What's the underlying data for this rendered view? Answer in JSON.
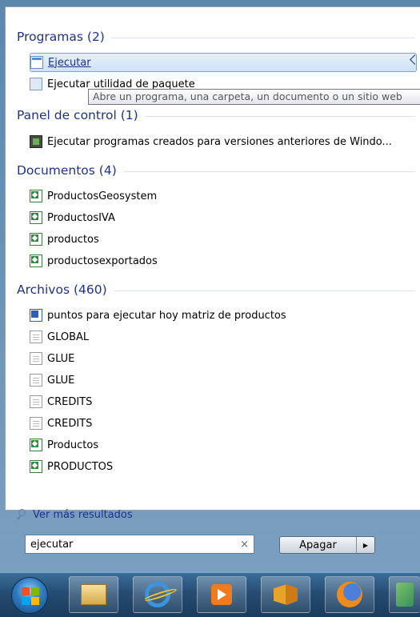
{
  "groups": {
    "programs": {
      "title": "Programas (2)",
      "items": [
        {
          "label": "Ejecutar",
          "icon": "run-icon",
          "selected": true
        },
        {
          "label": "Ejecutar utilidad de paquete",
          "icon": "package-icon"
        }
      ]
    },
    "control_panel": {
      "title": "Panel de control (1)",
      "items": [
        {
          "label": "Ejecutar programas creados para versiones anteriores de Windo...",
          "icon": "compatibility-icon"
        }
      ]
    },
    "documents": {
      "title": "Documentos (4)",
      "items": [
        {
          "label": "ProductosGeosystem",
          "icon": "excel-icon"
        },
        {
          "label": "ProductosIVA",
          "icon": "excel-icon"
        },
        {
          "label": "productos",
          "icon": "excel-icon"
        },
        {
          "label": "productosexportados",
          "icon": "excel-icon"
        }
      ]
    },
    "files": {
      "title": "Archivos (460)",
      "items": [
        {
          "label": "puntos para ejecutar hoy matriz de productos",
          "icon": "word-icon"
        },
        {
          "label": "GLOBAL",
          "icon": "text-file-icon"
        },
        {
          "label": "GLUE",
          "icon": "text-file-icon"
        },
        {
          "label": "GLUE",
          "icon": "text-file-icon"
        },
        {
          "label": "CREDITS",
          "icon": "text-file-icon"
        },
        {
          "label": "CREDITS",
          "icon": "text-file-icon"
        },
        {
          "label": "Productos",
          "icon": "excel-icon"
        },
        {
          "label": "PRODUCTOS",
          "icon": "excel-icon"
        }
      ]
    }
  },
  "tooltip": "Abre un programa, una carpeta, un documento o un sitio web",
  "more_results": "Ver más resultados",
  "search": {
    "value": "ejecutar",
    "clear": "×"
  },
  "shutdown": {
    "label": "Apagar",
    "arrow": "▶"
  },
  "taskbar": [
    "start-orb",
    "windows-explorer",
    "internet-explorer",
    "media-player",
    "office",
    "firefox",
    "app"
  ],
  "colors": {
    "accent": "#1e3287",
    "selection": "#cfe2f8",
    "taskbar": "#254c72"
  }
}
